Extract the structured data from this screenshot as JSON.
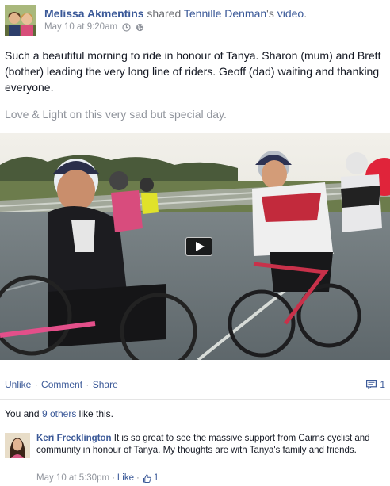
{
  "post": {
    "author": "Melissa Akmentins",
    "shared_word": "shared",
    "shared_owner": "Tennille Denman",
    "shared_suffix": "'s",
    "shared_object": "video",
    "shared_period": ".",
    "timestamp": "May 10 at 9:20am",
    "icons": [
      "avatar",
      "clock-icon",
      "globe-icon"
    ],
    "text": "Such a beautiful morning to ride in honour of Tanya. Sharon (mum) and Brett (bother) leading the very long line of riders. Geoff (dad) waiting and thanking everyone.",
    "text2": "Love & Light on this very sad but special day."
  },
  "video": {
    "play_icon": "play-icon"
  },
  "actions": {
    "unlike": "Unlike",
    "comment": "Comment",
    "share": "Share",
    "sep": "·",
    "comment_count": "1",
    "comment_icon": "comment-icon"
  },
  "likes": {
    "prefix": "You and ",
    "others_link": "9 others",
    "suffix": " like this."
  },
  "comment": {
    "author": "Keri Frecklington",
    "text": " It is so great to see the massive support from Cairns cyclist and community in honour of Tanya. My thoughts are with Tanya's family and friends.",
    "timestamp": "May 10 at 5:30pm",
    "sep": "·",
    "like": "Like",
    "sep2": "·",
    "like_count": "1",
    "like_icon": "thumbs-up-icon"
  },
  "colors": {
    "link": "#3b5998",
    "muted": "#90949c"
  }
}
